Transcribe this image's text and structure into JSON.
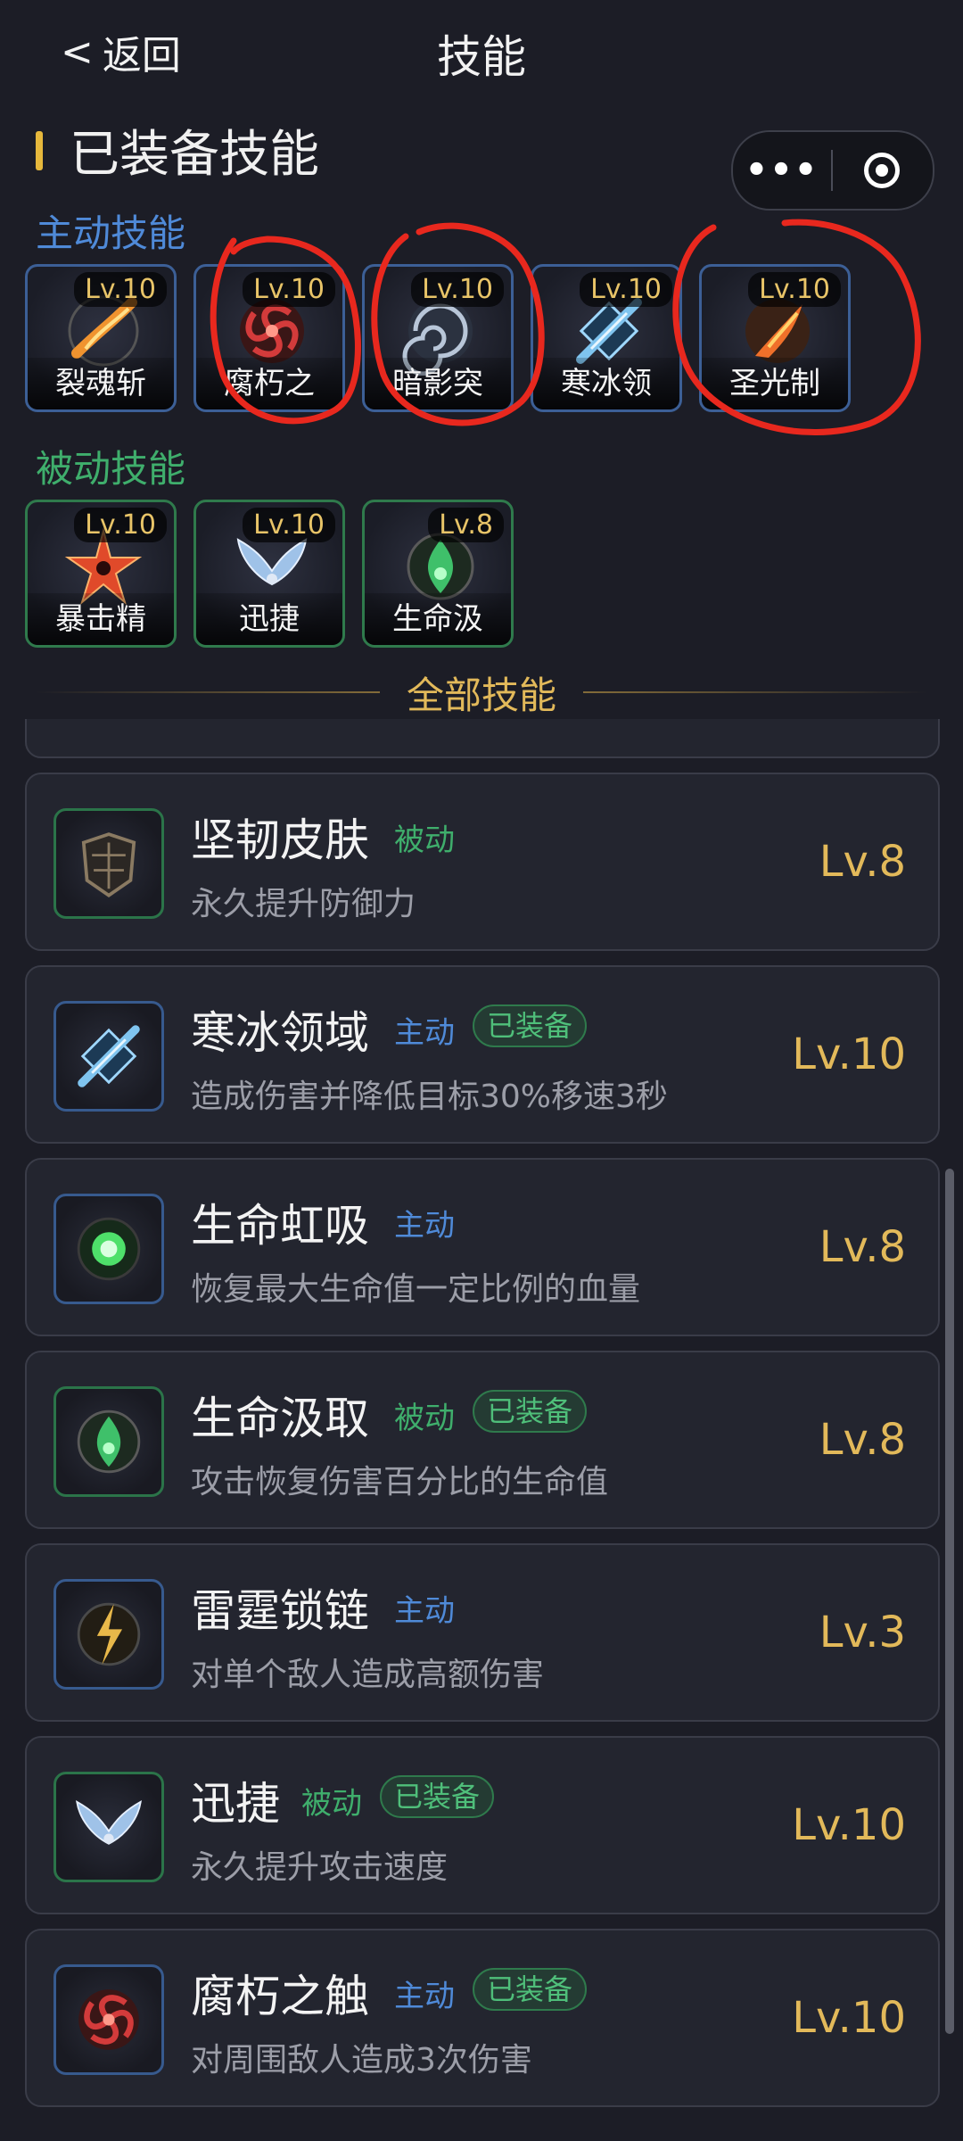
{
  "header": {
    "back_label": "返回",
    "back_icon": "chevron-left-icon",
    "title": "技能"
  },
  "capsule": {
    "more_icon": "more-dots-icon",
    "close_icon": "target-circle-icon"
  },
  "equipped": {
    "heading": "已装备技能",
    "active_label": "主动技能",
    "passive_label": "被动技能",
    "active": [
      {
        "level": "Lv.10",
        "name": "裂魂斩",
        "icon": "fiery-slash-icon",
        "color": "#f0932f"
      },
      {
        "level": "Lv.10",
        "name": "腐朽之",
        "icon": "red-vortex-icon",
        "color": "#d33b3b"
      },
      {
        "level": "Lv.10",
        "name": "暗影突",
        "icon": "shadow-swirl-icon",
        "color": "#b8c6d8"
      },
      {
        "level": "Lv.10",
        "name": "寒冰领",
        "icon": "ice-crystal-icon",
        "color": "#7fc4ef"
      },
      {
        "level": "Lv.10",
        "name": "圣光制",
        "icon": "holy-flame-icon",
        "color": "#f0702a"
      }
    ],
    "passive": [
      {
        "level": "Lv.10",
        "name": "暴击精",
        "icon": "crit-star-icon",
        "color": "#e04a2a"
      },
      {
        "level": "Lv.10",
        "name": "迅捷",
        "icon": "wing-icon",
        "color": "#9fc2e8"
      },
      {
        "level": "Lv.8",
        "name": "生命汲",
        "icon": "life-drain-icon",
        "color": "#3fc06a"
      }
    ]
  },
  "all_skills_label": "全部技能",
  "skills": [
    {
      "title": "坚韧皮肤",
      "type": "被动",
      "type_color": "green",
      "equipped": "",
      "desc": "永久提升防御力",
      "level": "Lv.8",
      "icon": "armor-icon",
      "color": "#8a7a62"
    },
    {
      "title": "寒冰领域",
      "type": "主动",
      "type_color": "blue",
      "equipped": "已装备",
      "desc": "造成伤害并降低目标30%移速3秒",
      "level": "Lv.10",
      "icon": "ice-crystal-icon",
      "color": "#7fc4ef"
    },
    {
      "title": "生命虹吸",
      "type": "主动",
      "type_color": "blue",
      "equipped": "",
      "desc": "恢复最大生命值一定比例的血量",
      "level": "Lv.8",
      "icon": "green-orb-icon",
      "color": "#4ee06a"
    },
    {
      "title": "生命汲取",
      "type": "被动",
      "type_color": "green",
      "equipped": "已装备",
      "desc": "攻击恢复伤害百分比的生命值",
      "level": "Lv.8",
      "icon": "life-drain-icon",
      "color": "#3fc06a"
    },
    {
      "title": "雷霆锁链",
      "type": "主动",
      "type_color": "blue",
      "equipped": "",
      "desc": "对单个敌人造成高额伤害",
      "level": "Lv.3",
      "icon": "lightning-icon",
      "color": "#e8b84a"
    },
    {
      "title": "迅捷",
      "type": "被动",
      "type_color": "green",
      "equipped": "已装备",
      "desc": "永久提升攻击速度",
      "level": "Lv.10",
      "icon": "wing-icon",
      "color": "#9fc2e8"
    },
    {
      "title": "腐朽之触",
      "type": "主动",
      "type_color": "blue",
      "equipped": "已装备",
      "desc": "对周围敌人造成3次伤害",
      "level": "Lv.10",
      "icon": "red-vortex-icon",
      "color": "#d33b3b"
    }
  ]
}
